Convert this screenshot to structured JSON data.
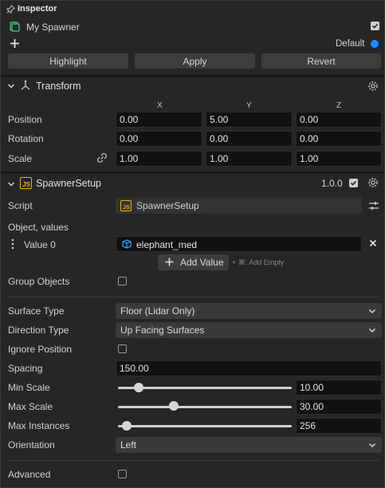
{
  "header": {
    "title": "Inspector",
    "object_name": "My Spawner",
    "object_enabled": true,
    "layer_label": "Default",
    "layer_color": "#1a8cff"
  },
  "actions": {
    "highlight": "Highlight",
    "apply": "Apply",
    "revert": "Revert"
  },
  "transform": {
    "title": "Transform",
    "axes": [
      "X",
      "Y",
      "Z"
    ],
    "position_label": "Position",
    "position": [
      "0.00",
      "5.00",
      "0.00"
    ],
    "rotation_label": "Rotation",
    "rotation": [
      "0.00",
      "0.00",
      "0.00"
    ],
    "scale_label": "Scale",
    "scale": [
      "1.00",
      "1.00",
      "1.00"
    ]
  },
  "component": {
    "title": "SpawnerSetup",
    "version": "1.0.0",
    "enabled": true,
    "script_label": "Script",
    "script_value": "SpawnerSetup",
    "object_values_label": "Object, values",
    "value0_label": "Value 0",
    "value0_value": "elephant_med",
    "add_value": "Add Value",
    "add_empty_hint": "+ ⌘: Add Empty",
    "group_objects_label": "Group Objects",
    "group_objects": false,
    "surface_type_label": "Surface Type",
    "surface_type": "Floor (Lidar Only)",
    "direction_type_label": "Direction Type",
    "direction_type": "Up Facing Surfaces",
    "ignore_position_label": "Ignore Position",
    "ignore_position": false,
    "spacing_label": "Spacing",
    "spacing": "150.00",
    "min_scale_label": "Min Scale",
    "min_scale": "10.00",
    "min_scale_level": 0.12,
    "max_scale_label": "Max Scale",
    "max_scale": "30.00",
    "max_scale_level": 0.32,
    "max_instances_label": "Max Instances",
    "max_instances": "256",
    "max_instances_level": 0.05,
    "orientation_label": "Orientation",
    "orientation": "Left",
    "advanced_label": "Advanced",
    "advanced": false
  },
  "colors": {
    "accent": "#1a8cff",
    "script_icon": "#e5b400",
    "object_icon": "#33aaff"
  }
}
